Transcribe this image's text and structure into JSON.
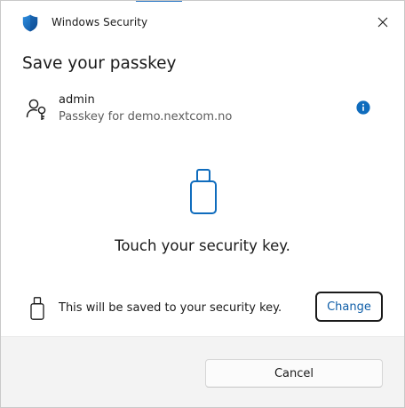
{
  "titlebar": {
    "title": "Windows Security",
    "icon": "shield-icon",
    "close_icon": "close-icon"
  },
  "heading": "Save your passkey",
  "account": {
    "name": "admin",
    "subtitle": "Passkey for demo.nextcom.no",
    "icon": "user-key-icon",
    "info_icon": "info-icon"
  },
  "prompt": {
    "illustration_icon": "security-key-icon",
    "text": "Touch your security key."
  },
  "destination": {
    "icon": "security-key-small-icon",
    "text": "This will be saved to your security key.",
    "change_label": "Change"
  },
  "footer": {
    "cancel_label": "Cancel"
  },
  "colors": {
    "accent": "#0f6cbd",
    "link_text": "#0f5ea8",
    "footer_bg": "#f3f3f3"
  }
}
